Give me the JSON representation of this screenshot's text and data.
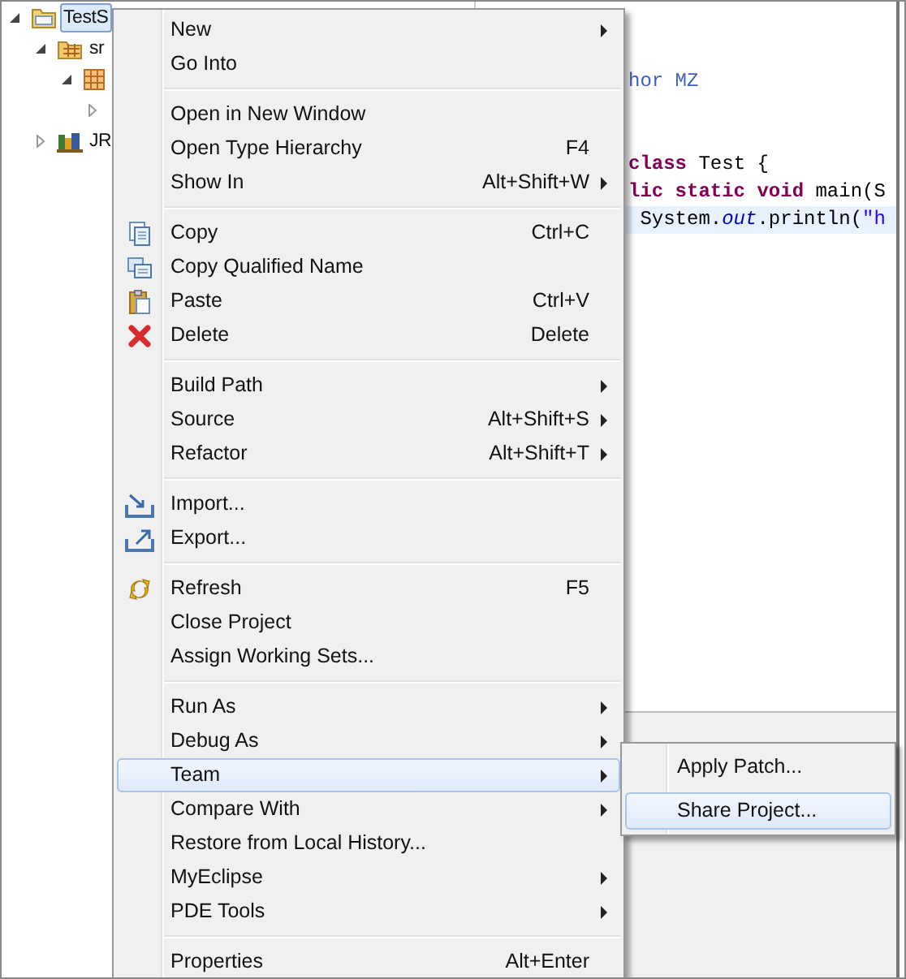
{
  "explorer": {
    "tree": [
      {
        "label": "TestS",
        "selected": true,
        "expanded": true,
        "children": [
          {
            "label": "sr",
            "selected": false,
            "expanded": true,
            "children": [
              {
                "expanded": true,
                "children": [
                  {
                    "expanded": false
                  }
                ]
              }
            ]
          },
          {
            "label": "JR",
            "selected": false,
            "expanded": false
          }
        ]
      }
    ]
  },
  "editor": {
    "code_blocks": [
      [
        {
          "current": false,
          "tokens": [
            {
              "kind": "comment",
              "text": "hor MZ"
            }
          ]
        }
      ],
      [
        {
          "current": false,
          "tokens": [
            {
              "kind": "keyword",
              "text": "class"
            },
            {
              "kind": "plain",
              "text": " Test {"
            }
          ]
        },
        {
          "current": false,
          "tokens": [
            {
              "kind": "keyword",
              "text": "lic static void"
            },
            {
              "kind": "plain",
              "text": " main(S"
            }
          ]
        },
        {
          "current": true,
          "tokens": [
            {
              "kind": "plain",
              "text": " System."
            },
            {
              "kind": "field",
              "text": "out"
            },
            {
              "kind": "plain",
              "text": ".println("
            },
            {
              "kind": "string",
              "text": "\"h"
            }
          ]
        }
      ]
    ]
  },
  "context_menu": {
    "groups": [
      [
        {
          "label": "New",
          "submenu": true,
          "selected": false
        },
        {
          "label": "Go Into",
          "submenu": false,
          "selected": false
        }
      ],
      [
        {
          "label": "Open in New Window",
          "submenu": false,
          "selected": false
        },
        {
          "label": "Open Type Hierarchy",
          "shortcut": "F4",
          "submenu": false,
          "selected": false
        },
        {
          "label": "Show In",
          "shortcut": "Alt+Shift+W",
          "submenu": true,
          "selected": false
        }
      ],
      [
        {
          "label": "Copy",
          "shortcut": "Ctrl+C",
          "submenu": false,
          "selected": false
        },
        {
          "label": "Copy Qualified Name",
          "submenu": false,
          "selected": false
        },
        {
          "label": "Paste",
          "shortcut": "Ctrl+V",
          "submenu": false,
          "selected": false
        },
        {
          "label": "Delete",
          "shortcut": "Delete",
          "submenu": false,
          "selected": false
        }
      ],
      [
        {
          "label": "Build Path",
          "submenu": true,
          "selected": false
        },
        {
          "label": "Source",
          "shortcut": "Alt+Shift+S",
          "submenu": true,
          "selected": false
        },
        {
          "label": "Refactor",
          "shortcut": "Alt+Shift+T",
          "submenu": true,
          "selected": false
        }
      ],
      [
        {
          "label": "Import...",
          "submenu": false,
          "selected": false
        },
        {
          "label": "Export...",
          "submenu": false,
          "selected": false
        }
      ],
      [
        {
          "label": "Refresh",
          "shortcut": "F5",
          "submenu": false,
          "selected": false
        },
        {
          "label": "Close Project",
          "submenu": false,
          "selected": false
        },
        {
          "label": "Assign Working Sets...",
          "submenu": false,
          "selected": false
        }
      ],
      [
        {
          "label": "Run As",
          "submenu": true,
          "selected": false
        },
        {
          "label": "Debug As",
          "submenu": true,
          "selected": false
        },
        {
          "label": "Team",
          "submenu": true,
          "selected": true
        },
        {
          "label": "Compare With",
          "submenu": true,
          "selected": false
        },
        {
          "label": "Restore from Local History...",
          "submenu": false,
          "selected": false
        },
        {
          "label": "MyEclipse",
          "submenu": true,
          "selected": false
        },
        {
          "label": "PDE Tools",
          "submenu": true,
          "selected": false
        }
      ],
      [
        {
          "label": "Properties",
          "shortcut": "Alt+Enter",
          "submenu": false,
          "selected": false
        }
      ]
    ]
  },
  "team_submenu": {
    "items": [
      {
        "label": "Apply Patch...",
        "selected": false
      },
      {
        "label": "Share Project...",
        "selected": true
      }
    ]
  }
}
